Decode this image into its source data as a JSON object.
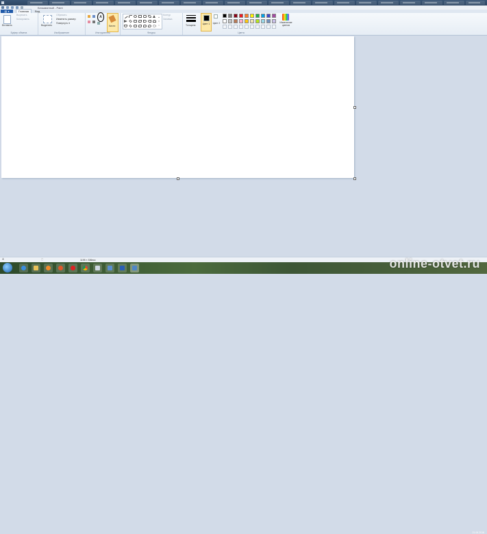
{
  "window": {
    "title": "Безымянный - Paint"
  },
  "ribbon_tabs": [
    {
      "label": "Главная"
    },
    {
      "label": "Вид"
    }
  ],
  "clipboard": {
    "paste": "Вставить",
    "cut": "Вырезать",
    "copy": "Копировать",
    "group": "Буфер обмена"
  },
  "image": {
    "select": "Выделить",
    "crop": "Обрезать",
    "resize": "Изменить размер",
    "rotate": "Повернуть ▾",
    "group": "Изображение"
  },
  "tools": {
    "group": "Инструменты",
    "brushes": "Кисти"
  },
  "shapes": {
    "group": "Фигуры",
    "outline": "Контур",
    "fill": "Заливка"
  },
  "colors": {
    "size": "Толщина",
    "color1": "Цвет 1",
    "color2": "Цвет 2",
    "edit": "Изменение цветов",
    "group": "Цвета",
    "palette_row1": [
      "#000000",
      "#7f7f7f",
      "#880015",
      "#ed1c24",
      "#ff7f27",
      "#fff200",
      "#22b14c",
      "#00a2e8",
      "#3f48cc",
      "#a349a4"
    ],
    "palette_row2": [
      "#ffffff",
      "#c3c3c3",
      "#b97a57",
      "#ffaec9",
      "#ffc90e",
      "#efe4b0",
      "#b5e61d",
      "#99d9ea",
      "#7092be",
      "#c8bfe7"
    ],
    "color1_value": "#000000",
    "color2_value": "#ffffff"
  },
  "status": {
    "canvas_size": "1195 × 336пкс"
  },
  "watermark": "online-otvet.ru",
  "tray": {
    "date": "21.06.2016"
  }
}
